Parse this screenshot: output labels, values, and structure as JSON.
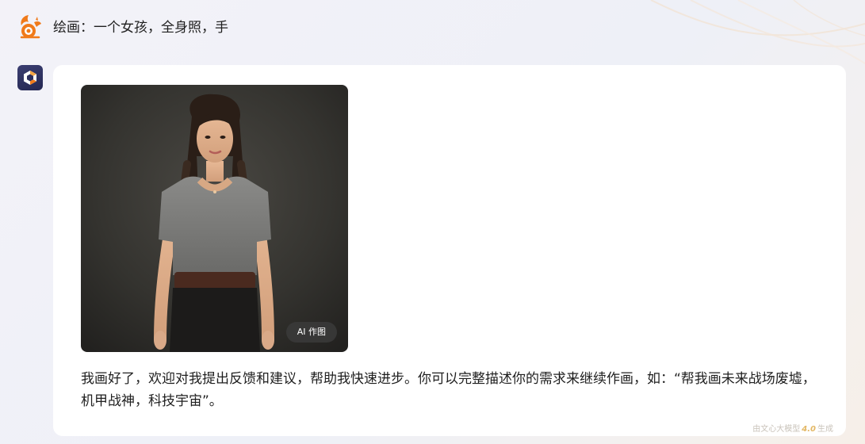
{
  "user_message": {
    "text": "绘画：一个女孩，全身照，手",
    "avatar_icon": "squirrel-logo-icon"
  },
  "reply": {
    "avatar_icon": "cube-logo-icon",
    "image_badge": "AI 作图",
    "text": "我画好了，欢迎对我提出反馈和建议，帮助我快速进步。你可以完整描述你的需求来继续作画，如：“帮我画未来战场废墟，机甲战神，科技宇宙”。",
    "model_note_prefix": "由文心大模型",
    "model_version": "4.0",
    "model_note_suffix": "生成"
  },
  "colors": {
    "accent_orange": "#f07a1a",
    "bot_avatar_bg": "#2c2f5e",
    "text_primary": "#1f1f1f",
    "note_gold": "#e3b866"
  }
}
